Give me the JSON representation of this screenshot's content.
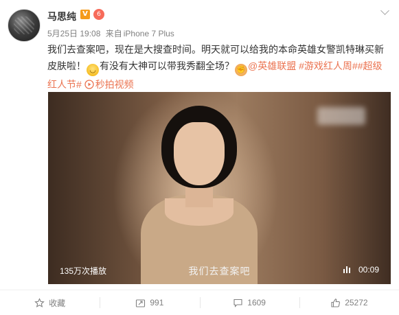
{
  "post": {
    "author": "马思纯",
    "vip_badge": "V",
    "level_badge": "6",
    "date": "5月25日 19:08",
    "source_prefix": "来自",
    "source": "iPhone 7 Plus",
    "text_1": "我们去查案吧，现在是大搜查时间。明天就可以给我的本命英雄女警凯特琳买新皮肤啦！",
    "text_2": "有没有大神可以带我秀翻全场？",
    "mention": "@英雄联盟",
    "hashtag_1": "#游戏红人周#",
    "hashtag_2": "#超级红人节#",
    "video_link": "秒拍视频"
  },
  "video": {
    "view_count": "135万次播放",
    "subtitle": "我们去查案吧",
    "duration": "00:09"
  },
  "actions": {
    "favorite": "收藏",
    "repost": "991",
    "comment": "1609",
    "like": "25272"
  },
  "colors": {
    "link": "#eb7350",
    "meta": "#808080",
    "vip": "#f59b1b"
  }
}
